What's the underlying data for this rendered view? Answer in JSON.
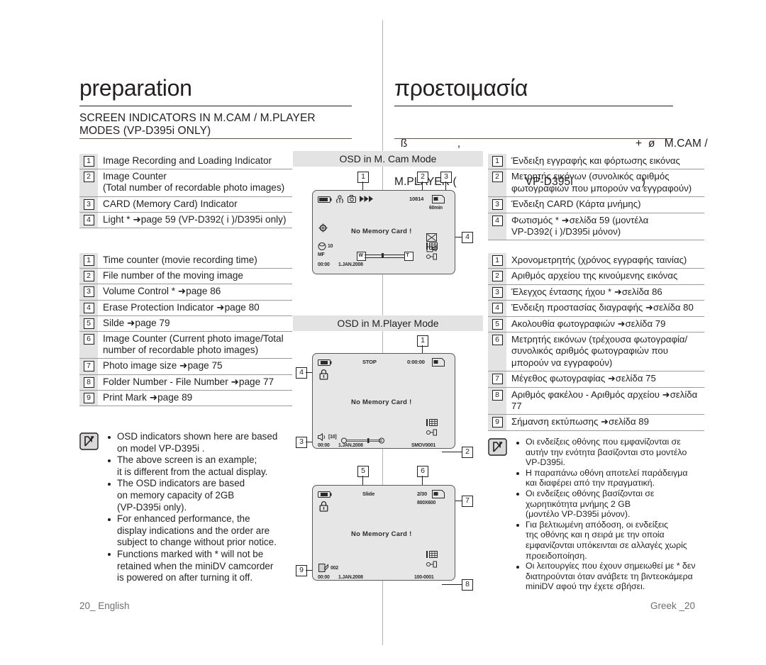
{
  "page": {
    "divider": true,
    "footer_left": "20_ English",
    "footer_right": "Greek _20"
  },
  "english": {
    "title": "preparation",
    "subtitle": "SCREEN INDICATORS IN M.CAM / M.PLAYER\nMODES (VP-D395i  ONLY)",
    "list_mcam": [
      {
        "n": "1",
        "text": "Image Recording and Loading Indicator"
      },
      {
        "n": "2",
        "text": "Image Counter\n(Total number of recordable photo images)"
      },
      {
        "n": "3",
        "text": "CARD (Memory Card) Indicator"
      },
      {
        "n": "4",
        "text": "Light * ➜page 59 (VP-D392( i )/D395i only)"
      }
    ],
    "list_mplayer": [
      {
        "n": "1",
        "text": "Time counter (movie recording time)"
      },
      {
        "n": "2",
        "text": "File number of the moving image"
      },
      {
        "n": "3",
        "text": "Volume Control * ➜page 86"
      },
      {
        "n": "4",
        "text": " Erase Protection Indicator ➜page 80"
      },
      {
        "n": "5",
        "text": "Silde ➜page 79"
      },
      {
        "n": "6",
        "text": "Image Counter (Current photo image/Total\nnumber of recordable photo images)"
      },
      {
        "n": "7",
        "text": "Photo image size ➜page 75"
      },
      {
        "n": "8",
        "text": "Folder Number - File Number  ➜page 77"
      },
      {
        "n": "9",
        "text": "Print Mark ➜page 89"
      }
    ],
    "notes": [
      "OSD indicators shown here are based\non model VP-D395i .",
      "The above screen is an example;\nit is different from the actual display.",
      "The OSD indicators are based\non memory capacity of 2GB\n(VP-D395i only).",
      "For enhanced performance, the\ndisplay indications and the order are\nsubject to change without prior notice.",
      "Functions marked with * will not be\nretained when the miniDV camcorder\nis powered on after turning it off."
    ]
  },
  "greek": {
    "title": "προετοιμασία",
    "subtitle_line1": "  ß                ,                                                        +  ø   M.CAM /",
    "subtitle_line2": "M.PLAYER (                      VP-D395i                      )",
    "list_mcam": [
      {
        "n": "1",
        "text": "Ένδειξη εγγραφής και φόρτωσης εικόνας"
      },
      {
        "n": "2",
        "text": "Μετρητής εικόνων (συνολικός αριθμός\nφωτογραφιών που μπορούν να εγγραφούν)"
      },
      {
        "n": "3",
        "text": "Ένδειξη CARD (Κάρτα μνήμης)"
      },
      {
        "n": "4",
        "text": "Φωτισμός * ➜σελίδα  59 (μοντέλα\nVP-D392( i )/D395i μόνον)"
      }
    ],
    "list_mplayer": [
      {
        "n": "1",
        "text": "Χρονομετρητής (χρόνος εγγραφής ταινίας)"
      },
      {
        "n": "2",
        "text": "Αριθμός αρχείου της κινούμενης εικόνας"
      },
      {
        "n": "3",
        "text": "Έλεγχος έντασης ήχου *  ➜σελίδα  86"
      },
      {
        "n": "4",
        "text": "Ένδειξη προστασίας διαγραφής ➜σελίδα  80"
      },
      {
        "n": "5",
        "text": "Ακολουθία φωτογραφιών ➜σελίδα  79"
      },
      {
        "n": "6",
        "text": "Μετρητής εικόνων (τρέχουσα φωτογραφία/\nσυνολικός αριθμός φωτογραφιών που\nμπορούν να εγγραφούν)"
      },
      {
        "n": "7",
        "text": "Μέγεθος φωτογραφίας ➜σελίδα  75"
      },
      {
        "n": "8",
        "text": "Αριθμός φακέλου - Αριθμός αρχείου ➜σελίδα 77"
      },
      {
        "n": "9",
        "text": "Σήμανση εκτύπωσης ➜σελίδα  89"
      }
    ],
    "notes": [
      "Οι ενδείξεις οθόνης που εμφανίζονται σε\nαυτήν την ενότητα βασίζονται στο μοντέλο\nVP-D395i.",
      "Η παραπάνω οθόνη αποτελεί παράδειγμα\nκαι διαφέρει από την πραγματική.",
      "Οι ενδείξεις οθόνης βασίζονται σε\nχωρητικότητα μνήμης 2 GB\n(μοντέλο VP-D395i μόνον).",
      "Για βελτιωμένη απόδοση, οι ενδείξεις\nτης οθόνης και η σειρά με την οποία\nεμφανίζονται υπόκεινται σε αλλαγές χωρίς\nπροειδοποίηση.",
      "Οι λειτουργίες που έχουν σημειωθεί με * δεν\nδιατηρούνται όταν ανάβετε τη βιντεοκάμερα\nminiDV αφού την έχετε σβήσει."
    ]
  },
  "figures": {
    "mcam": {
      "caption": "OSD in M. Cam Mode",
      "callouts": [
        "1",
        "2",
        "3",
        "4"
      ],
      "osd": {
        "counter": "10814",
        "rec_time": "60min",
        "message": "No Memory Card !",
        "quality_num": "10",
        "focus": "MF",
        "zoom_wide": "W",
        "zoom_tele": "T",
        "clock": "00:00",
        "date": "1.JAN.2008"
      }
    },
    "mplayer1": {
      "caption": "OSD in M.Player Mode",
      "callouts": [
        "1",
        "2",
        "3",
        "4"
      ],
      "osd": {
        "status": "STOP",
        "time": "0:00:00",
        "message": "No Memory Card !",
        "volume": "[10]",
        "clock": "00:00",
        "date": "1.JAN.2008",
        "file": "SMOV0001"
      }
    },
    "mplayer2": {
      "callouts": [
        "5",
        "6",
        "7",
        "8",
        "9"
      ],
      "osd": {
        "status": "Slide",
        "counter": "2/30",
        "size": "800X600",
        "message": "No Memory Card !",
        "print_count": "002",
        "clock": "00:00",
        "date": "1.JAN.2008",
        "folder_file": "100-0001"
      }
    }
  }
}
